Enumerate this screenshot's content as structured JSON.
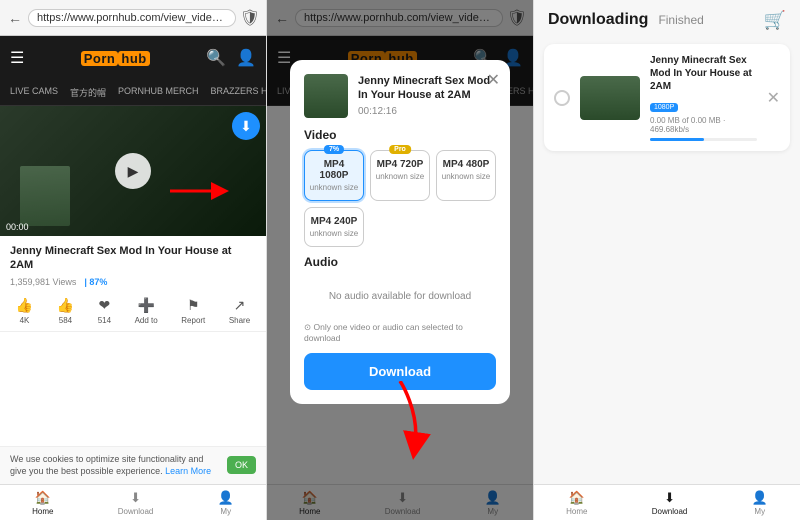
{
  "left": {
    "address_bar": {
      "url": "https://www.pornhub.com/view_video.php?vi...",
      "back_label": "←",
      "shield_icon": "🛡"
    },
    "header": {
      "menu_icon": "☰",
      "logo_prefix": "Porn",
      "logo_highlight": "hub",
      "search_icon": "🔍",
      "account_icon": "👤"
    },
    "nav_items": [
      "LIVE CAMS",
      "官方的帽",
      "PORNHUB MERCH",
      "BRAZZERS HD"
    ],
    "video": {
      "time": "00:00",
      "download_icon": "⬇"
    },
    "title": "Jenny Minecraft Sex Mod In Your House at 2AM",
    "stats": {
      "views": "1,359,981 Views",
      "rating": "| 87%"
    },
    "actions": [
      {
        "icon": "👍",
        "label": "4K"
      },
      {
        "icon": "👍",
        "label": "584"
      },
      {
        "icon": "❤",
        "label": "514"
      },
      {
        "icon": "➕",
        "label": "Add to"
      },
      {
        "icon": "⚑",
        "label": "Report"
      },
      {
        "icon": "↗",
        "label": "Share"
      }
    ],
    "cookie_bar": {
      "text": "We use cookies to optimize site functionality and give you the best possible experience.",
      "link": "Learn More",
      "ok_label": "OK"
    },
    "bottom_nav": [
      {
        "icon": "🏠",
        "label": "Home",
        "active": true
      },
      {
        "icon": "⬇",
        "label": "Download"
      },
      {
        "icon": "👤",
        "label": "My"
      }
    ]
  },
  "middle": {
    "address_bar": {
      "url": "https://www.pornhub.com/view_video.php?vi...",
      "back_label": "←",
      "shield_icon": "🛡"
    },
    "header": {
      "menu_icon": "☰",
      "logo_prefix": "Porn",
      "logo_highlight": "hub",
      "search_icon": "🔍",
      "account_icon": "👤"
    },
    "nav_items": [
      "LIVE CAMS",
      "官方的帽",
      "PORNHUB MERCH",
      "BRAZZERS HD"
    ],
    "modal": {
      "close_icon": "✕",
      "video_title": "Jenny Minecraft Sex Mod In Your House at 2AM",
      "duration": "00:12:16",
      "video_section": "Video",
      "quality_options": [
        {
          "label": "MP4 1080P",
          "sub": "unknown size",
          "badge": "7%",
          "badge_type": "normal",
          "selected": true
        },
        {
          "label": "MP4 720P",
          "sub": "unknown size",
          "badge": "Pro",
          "badge_type": "pro",
          "selected": false
        },
        {
          "label": "MP4 480P",
          "sub": "unknown size",
          "badge": null,
          "selected": false
        },
        {
          "label": "MP4 240P",
          "sub": "unknown size",
          "badge": null,
          "selected": false
        }
      ],
      "audio_section": "Audio",
      "no_audio_text": "No audio available for download",
      "note": "⊙ Only one video or audio can selected to download",
      "download_label": "Download"
    },
    "bottom_nav": [
      {
        "icon": "🏠",
        "label": "Home",
        "active": true
      },
      {
        "icon": "⬇",
        "label": "Download"
      },
      {
        "icon": "👤",
        "label": "My"
      }
    ]
  },
  "right": {
    "title": "Downloading",
    "subtitle": "Finished",
    "toolbar_icon": "🛒",
    "download_item": {
      "title": "Jenny Minecraft Sex Mod In Your House at 2AM",
      "badge": "1080P",
      "progress_text": "0.00 MB of 0.00 MB · 469.68kb/s",
      "progress_pct": 51,
      "close_icon": "✕"
    },
    "bottom_nav": [
      {
        "icon": "🏠",
        "label": "Home"
      },
      {
        "icon": "⬇",
        "label": "Download",
        "active": true
      },
      {
        "icon": "👤",
        "label": "My"
      }
    ]
  }
}
